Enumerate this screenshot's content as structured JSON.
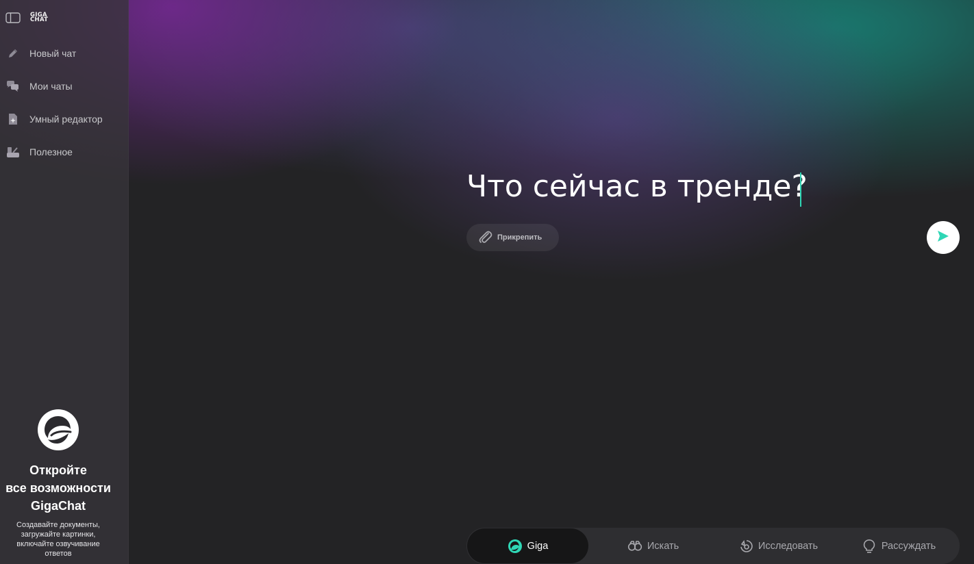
{
  "app": {
    "logo_line1": "GIGA",
    "logo_line2": "CHAT"
  },
  "sidebar": {
    "toggle_icon": "sidebar-panel-icon",
    "items": [
      {
        "label": "Новый чат",
        "icon": "pencil-icon"
      },
      {
        "label": "Мои чаты",
        "icon": "chat-bubbles-icon"
      },
      {
        "label": "Умный редактор",
        "icon": "smart-editor-icon"
      },
      {
        "label": "Полезное",
        "icon": "toolbox-icon"
      }
    ],
    "promo": {
      "title_line1": "Откройте",
      "title_line2": "все возможности",
      "title_line3": "GigaChat",
      "description": "Создавайте документы, загружайте картинки, включайте озвучивание ответов"
    }
  },
  "composer": {
    "text": "Что сейчас в тренде?",
    "attach_label": "Прикрепить",
    "send_icon": "send-arrow-icon"
  },
  "modes": {
    "items": [
      {
        "label": "Giga",
        "icon": "giga-logo-icon",
        "active": true
      },
      {
        "label": "Искать",
        "icon": "binoculars-icon",
        "active": false
      },
      {
        "label": "Исследовать",
        "icon": "research-icon",
        "active": false
      },
      {
        "label": "Рассуждать",
        "icon": "lightbulb-icon",
        "active": false
      }
    ]
  },
  "colors": {
    "accent": "#2fd6b5",
    "background": "#232325",
    "sidebar": "#37343a"
  }
}
